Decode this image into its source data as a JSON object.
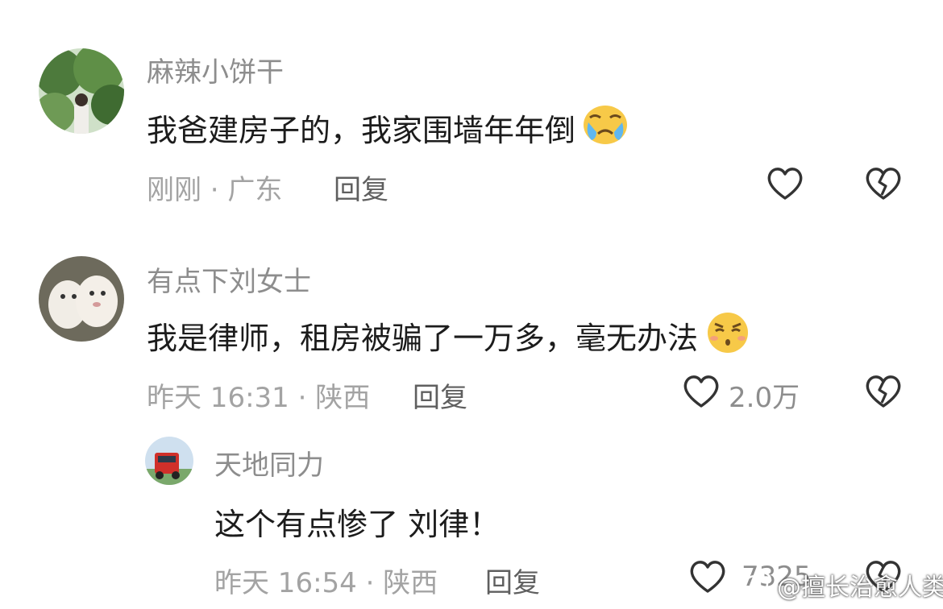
{
  "comments": [
    {
      "username": "麻辣小饼干",
      "text": "我爸建房子的，我家围墙年年倒",
      "emoji": "crying-face-emoji",
      "meta": "刚刚 · 广东",
      "reply_label": "回复",
      "like_count": ""
    },
    {
      "username": "有点下刘女士",
      "text": "我是律师，租房被骗了一万多，毫无办法",
      "emoji": "speechless-face-emoji",
      "meta": "昨天 16:31 · 陕西",
      "reply_label": "回复",
      "like_count": "2.0万"
    }
  ],
  "replies": [
    {
      "username": "天地同力",
      "text": "这个有点惨了 刘律！",
      "meta": "昨天 16:54 · 陕西",
      "reply_label": "回复",
      "like_count": "7325"
    }
  ],
  "watermark": "@擅长治愈人类",
  "colors": {
    "username": "#8d8d8d",
    "meta": "#a3a3a3",
    "reply": "#5f5f5f",
    "icon": "#333333"
  }
}
